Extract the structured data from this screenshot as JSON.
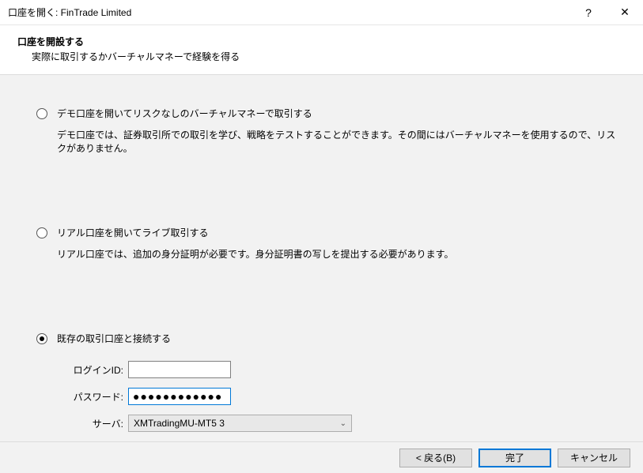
{
  "titlebar": {
    "title": "口座を開く: FinTrade Limited",
    "help": "?",
    "close": "✕"
  },
  "header": {
    "title": "口座を開設する",
    "subtitle": "実際に取引するかバーチャルマネーで経験を得る"
  },
  "options": {
    "demo": {
      "label": "デモ口座を開いてリスクなしのバーチャルマネーで取引する",
      "desc": "デモ口座では、証券取引所での取引を学び、戦略をテストすることができます。その間にはバーチャルマネーを使用するので、リスクがありません。"
    },
    "real": {
      "label": "リアル口座を開いてライブ取引する",
      "desc": "リアル口座では、追加の身分証明が必要です。身分証明書の写しを提出する必要があります。"
    },
    "existing": {
      "label": "既存の取引口座と接続する"
    }
  },
  "form": {
    "login_label": "ログインID:",
    "login_value": "",
    "password_label": "パスワード:",
    "password_mask": "●●●●●●●●●●●●",
    "server_label": "サーバ:",
    "server_value": "XMTradingMU-MT5 3"
  },
  "footer": {
    "back": "< 戻る(B)",
    "finish": "完了",
    "cancel": "キャンセル"
  }
}
